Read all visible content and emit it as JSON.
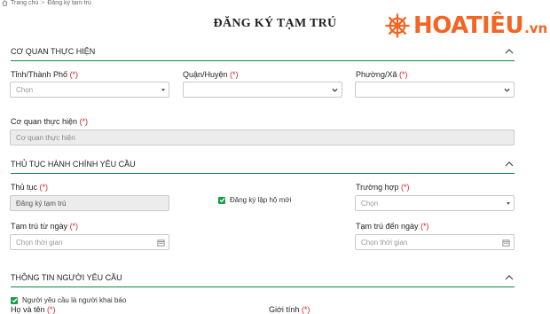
{
  "breadcrumb": {
    "home": "Trang chủ",
    "separator": ">",
    "current": "Đăng ký tạm trú"
  },
  "page_title": "ĐĂNG KÝ TẠM TRÚ",
  "logo": {
    "main": "HOATIÊU",
    "suffix": ".vn",
    "color": "#f26522"
  },
  "accent_color": "#0f8a3c",
  "sections": {
    "agency": {
      "title": "CƠ QUAN THỰC HIỆN"
    },
    "procedure": {
      "title": "THỦ TỤC HÀNH CHÍNH YÊU CẦU"
    },
    "requester": {
      "title": "THÔNG TIN NGƯỜI YÊU CẦU"
    }
  },
  "required_mark": "(*)",
  "fields": {
    "province": {
      "label": "Tỉnh/Thành Phố",
      "value": "Chọn"
    },
    "district": {
      "label": "Quận/Huyện",
      "value": ""
    },
    "ward": {
      "label": "Phường/Xã",
      "value": ""
    },
    "agency": {
      "label": "Cơ quan thực hiện",
      "placeholder": "Cơ quan thực hiện"
    },
    "procedure": {
      "label": "Thủ tục",
      "value": "Đăng ký tạm trú"
    },
    "new_household": {
      "label": "Đăng ký lập hộ mới",
      "checked": true
    },
    "case": {
      "label": "Trường hợp",
      "value": "Chọn"
    },
    "from_date": {
      "label": "Tạm trú từ ngày",
      "placeholder": "Chọn thời gian"
    },
    "to_date": {
      "label": "Tạm trú đến ngày",
      "placeholder": "Chọn thời gian"
    },
    "is_declarant": {
      "label": "Người yêu cầu là người khai báo",
      "checked": true
    },
    "full_name": {
      "label": "Họ và tên"
    },
    "gender": {
      "label": "Giới tính"
    }
  }
}
